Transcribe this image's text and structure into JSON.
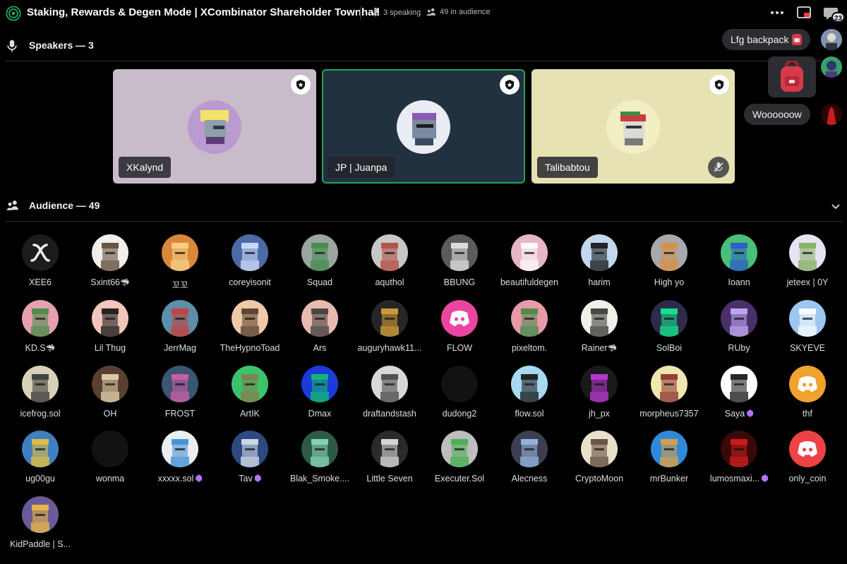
{
  "header": {
    "title": "Staking, Rewards & Degen Mode | XCombinator Shareholder Townhall",
    "speaking_count": "3 speaking",
    "audience_count": "49 in audience",
    "chat_badge": "23",
    "icons": [
      "stage-icon",
      "microphone-icon",
      "people-icon",
      "more-icon",
      "popout-icon",
      "chat-icon"
    ]
  },
  "speakers": {
    "header": "Speakers — 3",
    "items": [
      {
        "name": "XKalynd",
        "muted": false,
        "active": false,
        "bg": "#c8bccb"
      },
      {
        "name": "JP | Juanpa",
        "muted": false,
        "active": true,
        "bg": "#213140"
      },
      {
        "name": "Talibabtou",
        "muted": true,
        "active": false,
        "bg": "#e6e2b3"
      }
    ]
  },
  "audience": {
    "header": "Audience — 49",
    "members": [
      {
        "name": "XEE6",
        "bg": "#1c1c1c",
        "fg": "#eeeeee",
        "glyph": "𝓍"
      },
      {
        "name": "Sxint66",
        "suffix": "🦈",
        "bg": "#f0efe9",
        "fg": "#5b4330",
        "glyph": "◕"
      },
      {
        "name": "꼬꼬",
        "bg": "#d9873a",
        "fg": "#f8d58a",
        "glyph": "◕"
      },
      {
        "name": "coreyisonit",
        "bg": "#4c6aa8",
        "fg": "#d7e3ff",
        "glyph": "◕"
      },
      {
        "name": "Squad",
        "bg": "#9aa5a0",
        "fg": "#3f8a45",
        "glyph": "◕"
      },
      {
        "name": "aquthol",
        "bg": "#c9c7c4",
        "fg": "#b0463c",
        "glyph": "◕"
      },
      {
        "name": "BBUNG",
        "bg": "#5b5b5b",
        "fg": "#e9e9e9",
        "glyph": "◕"
      },
      {
        "name": "beautifuldegen",
        "bg": "#e6b5c6",
        "fg": "#ffffff",
        "glyph": "◕"
      },
      {
        "name": "harim",
        "bg": "#c2d8ef",
        "fg": "#111111",
        "glyph": "◕"
      },
      {
        "name": "High yo",
        "bg": "#a8a8b0",
        "fg": "#d98f3a",
        "glyph": "◕"
      },
      {
        "name": "Ioann",
        "bg": "#47c07a",
        "fg": "#2b57c9",
        "glyph": "◕"
      },
      {
        "name": "jeteex | 0Y",
        "bg": "#e8e2f4",
        "fg": "#7fae5a",
        "glyph": "◕"
      },
      {
        "name": "KD.S",
        "suffix": "🦈",
        "bg": "#e7a0ad",
        "fg": "#3f8a45",
        "glyph": "◕"
      },
      {
        "name": "Lil Thug",
        "bg": "#f2c6bd",
        "fg": "#111111",
        "glyph": "◕"
      },
      {
        "name": "JerrMag",
        "bg": "#5d8ea7",
        "fg": "#cc3b3b",
        "glyph": "◕"
      },
      {
        "name": "TheHypnoToad",
        "bg": "#f0c9a6",
        "fg": "#4d3a2a",
        "glyph": "◕"
      },
      {
        "name": "Ars",
        "bg": "#e8b9b0",
        "fg": "#3a3a3a",
        "glyph": "◕"
      },
      {
        "name": "auguryhawk11...",
        "bg": "#262626",
        "fg": "#e0a53a",
        "glyph": "◕"
      },
      {
        "name": "FLOW",
        "bg": "#eb459f",
        "fg": "#ffffff",
        "glyph": "discord"
      },
      {
        "name": "pixeltom.",
        "bg": "#e89aa8",
        "fg": "#3f8a45",
        "glyph": "◕"
      },
      {
        "name": "Rainer",
        "suffix": "🦈",
        "bg": "#f0efe9",
        "fg": "#333333",
        "glyph": "◕"
      },
      {
        "name": "SolBoi",
        "bg": "#2d2a4a",
        "fg": "#14f195",
        "glyph": "◕"
      },
      {
        "name": "RUby",
        "bg": "#4b2f6a",
        "fg": "#c9b3ff",
        "glyph": "◕"
      },
      {
        "name": "SKYEVE",
        "bg": "#9cc7f0",
        "fg": "#ffffff",
        "glyph": "◕"
      },
      {
        "name": "icefrog.sol",
        "bg": "#d8d0b8",
        "fg": "#333333",
        "glyph": "◕"
      },
      {
        "name": "OH",
        "bg": "#5a4030",
        "fg": "#e9d8b5",
        "glyph": "◕"
      },
      {
        "name": "FROST",
        "bg": "#3c5670",
        "fg": "#d35fae",
        "glyph": "◕"
      },
      {
        "name": "ArtIK",
        "bg": "#39c46b",
        "fg": "#8a7b4a",
        "glyph": "◕"
      },
      {
        "name": "Dmax",
        "bg": "#1a3bd9",
        "fg": "#13c26b",
        "glyph": "◕"
      },
      {
        "name": "draftandstash",
        "bg": "#d8d8d8",
        "fg": "#444444",
        "glyph": "◕"
      },
      {
        "name": "dudong2",
        "bg": "#121212",
        "fg": "#121212",
        "glyph": ""
      },
      {
        "name": "flow.sol",
        "bg": "#a8d9f0",
        "fg": "#111111",
        "glyph": "◕"
      },
      {
        "name": "jh_px",
        "bg": "#1a1a1a",
        "fg": "#c43be0",
        "glyph": "◕"
      },
      {
        "name": "morpheus7357",
        "bg": "#f0e6b0",
        "fg": "#8a2b2b",
        "glyph": "◕"
      },
      {
        "name": "Saya",
        "gem": true,
        "bg": "#ffffff",
        "fg": "#111111",
        "glyph": "◕"
      },
      {
        "name": "thf",
        "bg": "#f0a22e",
        "fg": "#ffffff",
        "glyph": "discord"
      },
      {
        "name": "ug00gu",
        "bg": "#3f7fc0",
        "fg": "#f0c23a",
        "glyph": "◕"
      },
      {
        "name": "wonma",
        "bg": "#121212",
        "fg": "#121212",
        "glyph": ""
      },
      {
        "name": "xxxxx.sol",
        "gem": true,
        "bg": "#e9eef2",
        "fg": "#3a8ad0",
        "glyph": "◕"
      },
      {
        "name": "Tav",
        "gem": true,
        "bg": "#2c4a80",
        "fg": "#e0e6f0",
        "glyph": "◕"
      },
      {
        "name": "Blak_Smoke....",
        "bg": "#2d5a48",
        "fg": "#8fe0c0",
        "glyph": "◕"
      },
      {
        "name": "Little Seven",
        "bg": "#2a2a2a",
        "fg": "#e8e8e8",
        "glyph": "◕"
      },
      {
        "name": "Executer.Sol",
        "bg": "#bdbdbd",
        "fg": "#3fae4a",
        "glyph": "◕"
      },
      {
        "name": "Alecness",
        "bg": "#3c3f54",
        "fg": "#9ac0e8",
        "glyph": "◕"
      },
      {
        "name": "CryptoMoon",
        "bg": "#e8e0c8",
        "fg": "#5a4636",
        "glyph": "◕"
      },
      {
        "name": "mrBunker",
        "bg": "#2e8ad8",
        "fg": "#e8a040",
        "glyph": "◕"
      },
      {
        "name": "lumosmaxi...",
        "gem": true,
        "bg": "#3a0808",
        "fg": "#d81f1f",
        "glyph": "◕"
      },
      {
        "name": "only_coin",
        "bg": "#ed4245",
        "fg": "#ffffff",
        "glyph": "discord"
      },
      {
        "name": "KidPaddle | S...",
        "bg": "#6a5a9a",
        "fg": "#f0c040",
        "glyph": "◕"
      }
    ]
  },
  "reactions": {
    "messages": [
      {
        "text": "Lfg backpack",
        "emoji": "backpack"
      },
      {
        "text": "sticker",
        "emoji": "backpack"
      },
      {
        "text": "Woooooow"
      }
    ],
    "bubble_1": "Lfg backpack",
    "bubble_2": "Woooooow"
  },
  "colors": {
    "active_speaker": "#23a55a",
    "nitro_gem": "#b473f5",
    "discord_blurple": "#5865f2"
  }
}
